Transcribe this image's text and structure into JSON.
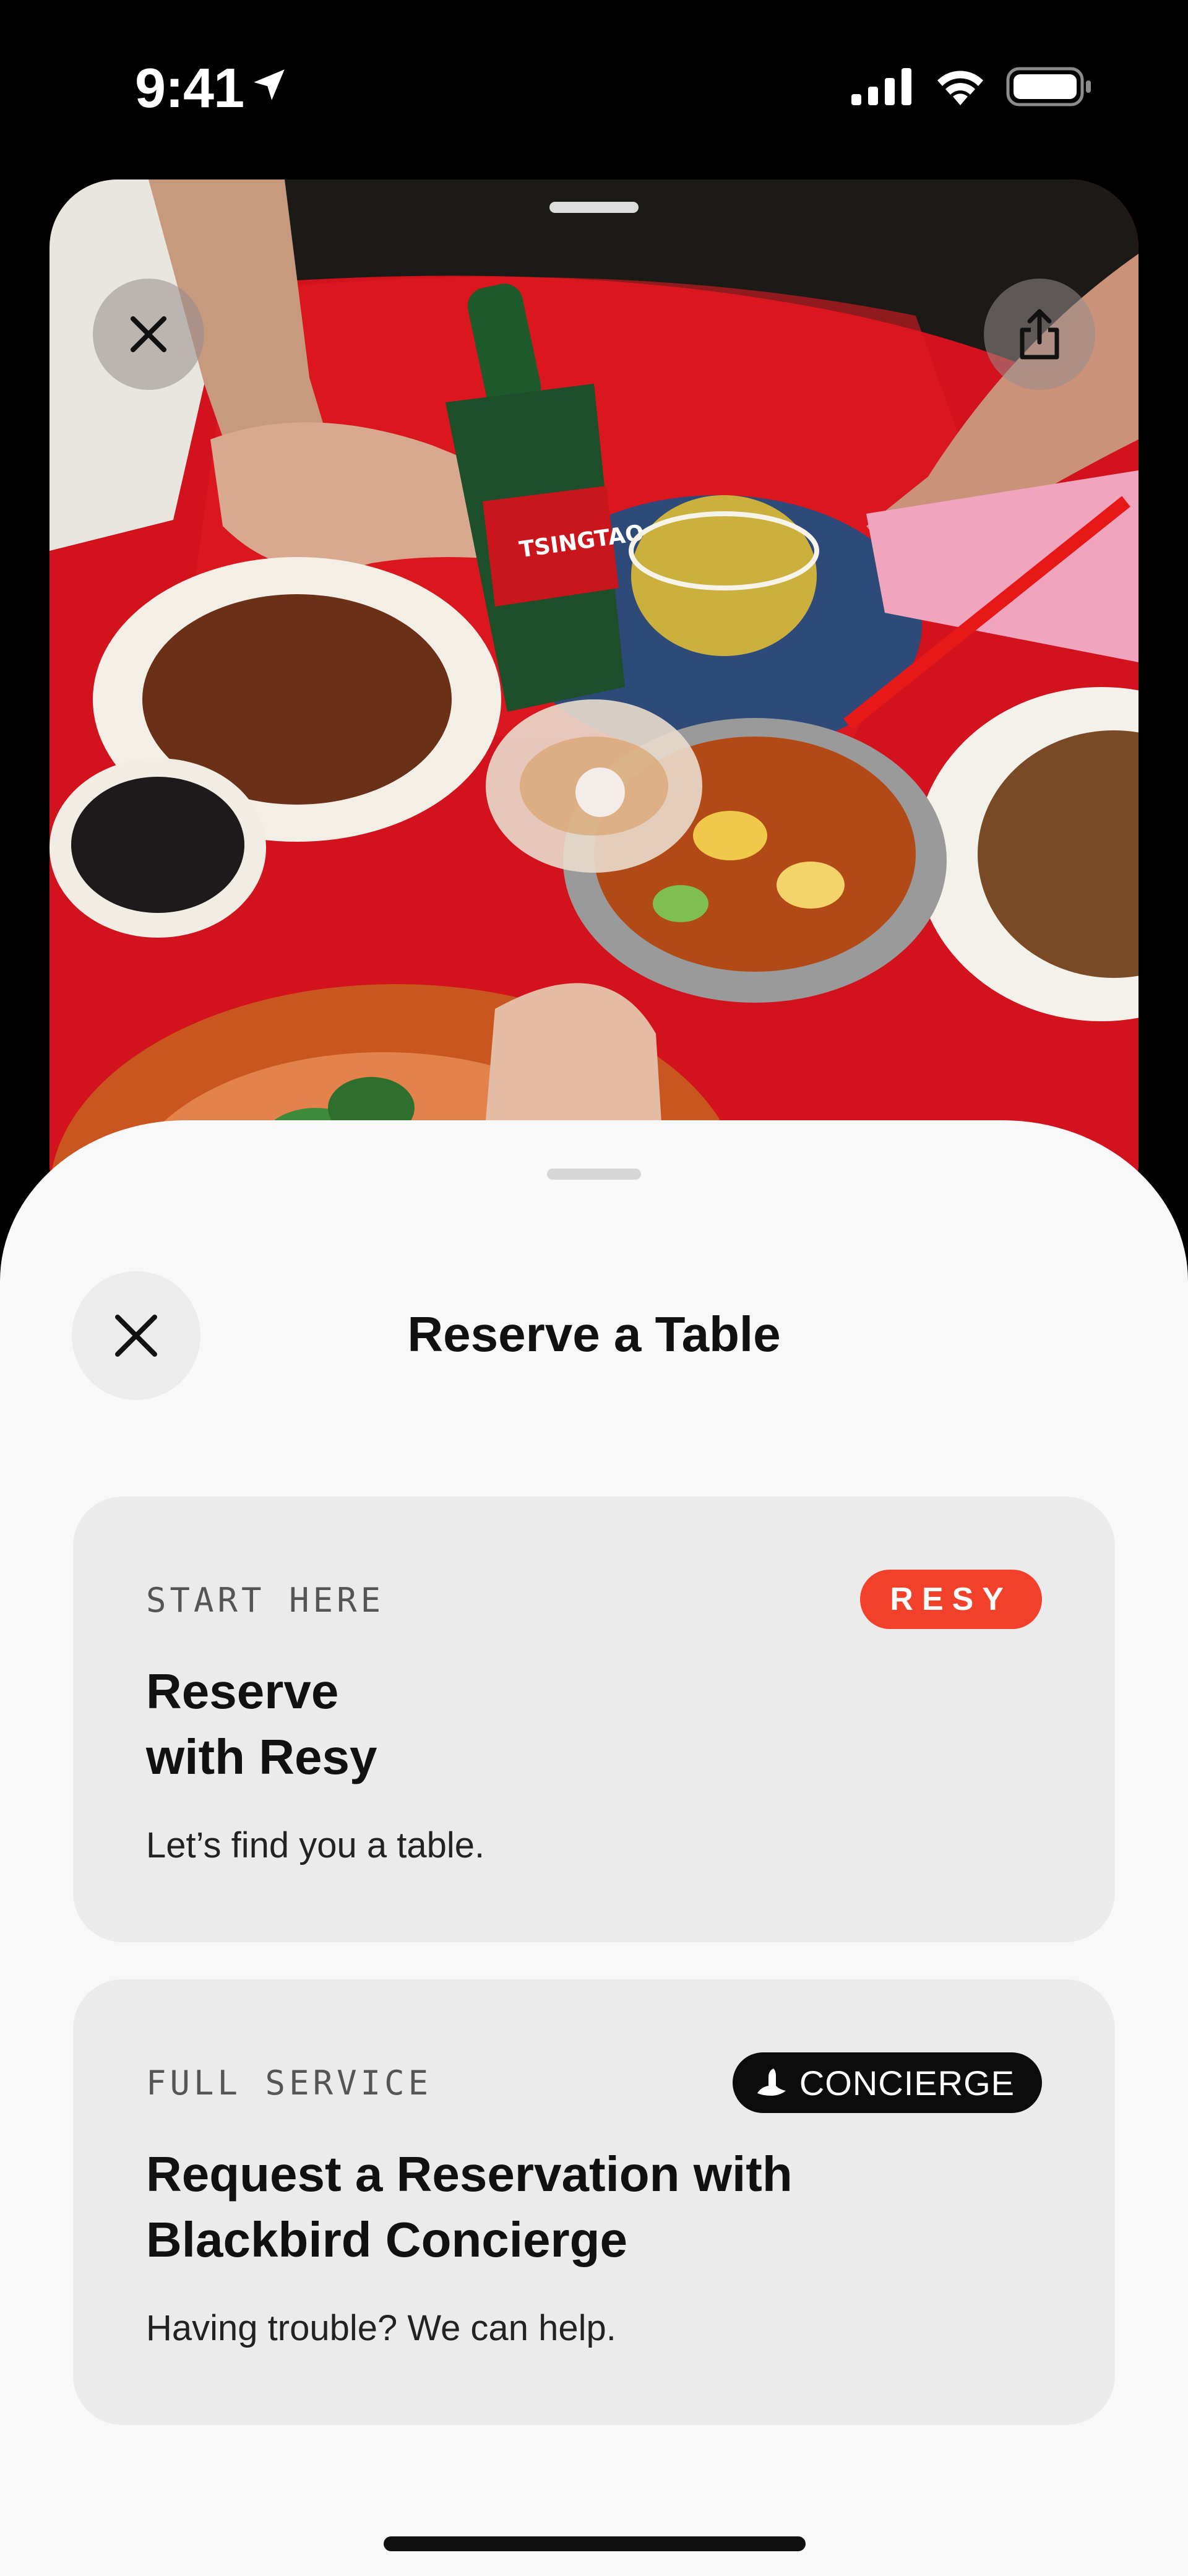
{
  "status_bar": {
    "time": "9:41",
    "icons": [
      "location-arrow-icon",
      "cellular-signal-icon",
      "wifi-icon",
      "battery-icon"
    ]
  },
  "photo_card": {
    "image": "Overhead photo of hands toasting drinks over plates of food on a red table, with a green bottle labeled TSINGTAO",
    "bottle_label": "TSINGTAO",
    "close_icon": "close-icon",
    "share_icon": "share-icon"
  },
  "sheet": {
    "title": "Reserve a Table",
    "close_icon": "close-icon"
  },
  "options": [
    {
      "eyebrow": "START HERE",
      "badge": "RESY",
      "heading_line1": "Reserve",
      "heading_line2": "with Resy",
      "subtitle": "Let’s find you a table."
    },
    {
      "eyebrow": "FULL SERVICE",
      "badge": "CONCIERGE",
      "badge_icon": "blackbird-icon",
      "heading_line1": "Request a Reservation with",
      "heading_line2": "Blackbird Concierge",
      "subtitle": "Having trouble? We can help."
    }
  ],
  "colors": {
    "resy_badge": "#f2412b",
    "concierge_badge": "#0c0c0c",
    "sheet_background": "#f8f8f8",
    "card_background": "#ebebeb",
    "table_red": "#c8101a"
  }
}
